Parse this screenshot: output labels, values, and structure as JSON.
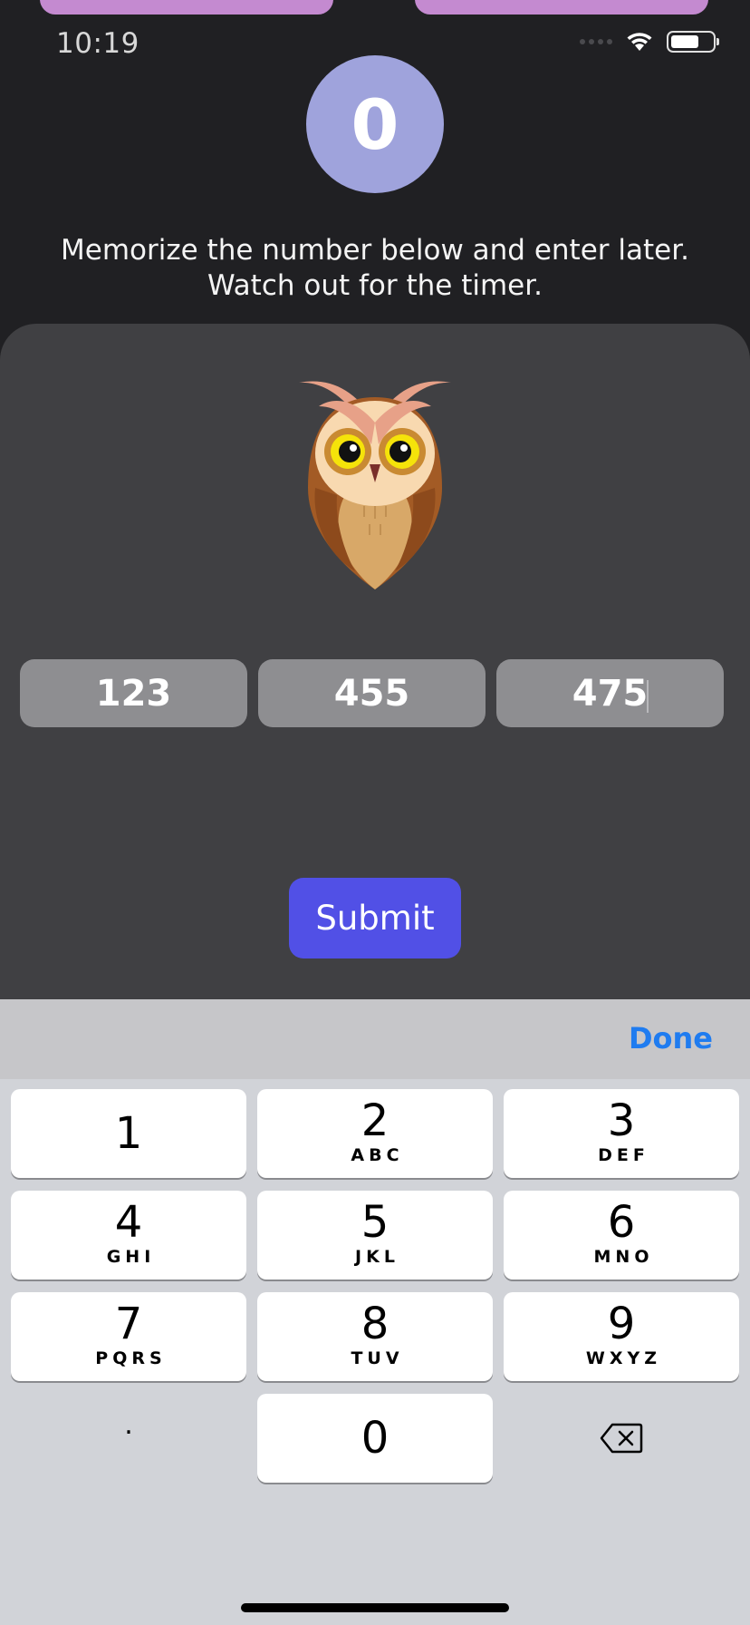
{
  "status": {
    "time": "10:19"
  },
  "score": "0",
  "instructions": {
    "line1": "Memorize the number below and enter later.",
    "line2": "Watch out for the timer."
  },
  "numbers": [
    "123",
    "455",
    "475"
  ],
  "submit_label": "Submit",
  "keyboard": {
    "done_label": "Done",
    "keys": [
      {
        "digit": "1",
        "letters": ""
      },
      {
        "digit": "2",
        "letters": "ABC"
      },
      {
        "digit": "3",
        "letters": "DEF"
      },
      {
        "digit": "4",
        "letters": "GHI"
      },
      {
        "digit": "5",
        "letters": "JKL"
      },
      {
        "digit": "6",
        "letters": "MNO"
      },
      {
        "digit": "7",
        "letters": "PQRS"
      },
      {
        "digit": "8",
        "letters": "TUV"
      },
      {
        "digit": "9",
        "letters": "WXYZ"
      },
      {
        "digit": "0",
        "letters": ""
      }
    ],
    "decimal_key": "."
  },
  "icons": {
    "wifi": "wifi-icon",
    "battery": "battery-icon",
    "owl": "owl-icon",
    "delete": "backspace-icon"
  },
  "colors": {
    "score_circle": "#9fa3dc",
    "submit": "#5150e6",
    "done": "#1f7cf0",
    "top_pill": "#c48ad0"
  }
}
